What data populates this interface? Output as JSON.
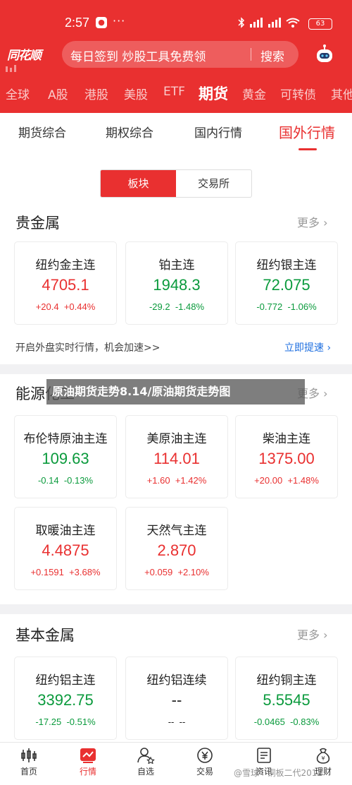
{
  "status_bar": {
    "time": "2:57",
    "dots": "···",
    "battery": "63"
  },
  "header": {
    "logo": "同花顺",
    "search_placeholder": "每日签到 炒股工具免费领",
    "search_button": "搜索"
  },
  "market_tabs": [
    "全球",
    "A股",
    "港股",
    "美股",
    "ETF",
    "期货",
    "黄金",
    "可转债",
    "其他"
  ],
  "market_tab_active": "期货",
  "sub_tabs": [
    "期货综合",
    "期权综合",
    "国内行情",
    "国外行情"
  ],
  "sub_tab_active": "国外行情",
  "segment": {
    "left": "板块",
    "right": "交易所",
    "active": "板块"
  },
  "sections": [
    {
      "title": "贵金属",
      "more": "更多",
      "cards": [
        {
          "name": "纽约金主连",
          "price": "4705.1",
          "change": "+20.4",
          "pct": "+0.44%",
          "trend": "up"
        },
        {
          "name": "铂主连",
          "price": "1948.3",
          "change": "-29.2",
          "pct": "-1.48%",
          "trend": "down"
        },
        {
          "name": "纽约银主连",
          "price": "72.075",
          "change": "-0.772",
          "pct": "-1.06%",
          "trend": "down"
        }
      ],
      "promo": "开启外盘实时行情，机会加速>>",
      "promo_link": "立即提速"
    },
    {
      "title": "能源化工",
      "more": "更多",
      "cards": [
        {
          "name": "布伦特原油主连",
          "price": "109.63",
          "change": "-0.14",
          "pct": "-0.13%",
          "trend": "down"
        },
        {
          "name": "美原油主连",
          "price": "114.01",
          "change": "+1.60",
          "pct": "+1.42%",
          "trend": "up"
        },
        {
          "name": "柴油主连",
          "price": "1375.00",
          "change": "+20.00",
          "pct": "+1.48%",
          "trend": "up"
        },
        {
          "name": "取暖油主连",
          "price": "4.4875",
          "change": "+0.1591",
          "pct": "+3.68%",
          "trend": "up"
        },
        {
          "name": "天然气主连",
          "price": "2.870",
          "change": "+0.059",
          "pct": "+2.10%",
          "trend": "up"
        }
      ]
    },
    {
      "title": "基本金属",
      "more": "更多",
      "cards": [
        {
          "name": "纽约铝主连",
          "price": "3392.75",
          "change": "-17.25",
          "pct": "-0.51%",
          "trend": "down"
        },
        {
          "name": "纽约铝连续",
          "price": "--",
          "change": "--",
          "pct": "--",
          "trend": "none"
        },
        {
          "name": "纽约铜主连",
          "price": "5.5545",
          "change": "-0.0465",
          "pct": "-0.83%",
          "trend": "down"
        }
      ]
    }
  ],
  "overlay_caption": "原油期货走势8.14/原油期货走势图",
  "bottom_nav": [
    {
      "label": "首页",
      "icon": "chart-bars-icon"
    },
    {
      "label": "行情",
      "icon": "market-trend-icon"
    },
    {
      "label": "自选",
      "icon": "person-star-icon"
    },
    {
      "label": "交易",
      "icon": "yen-coin-icon"
    },
    {
      "label": "资讯",
      "icon": "news-doc-icon"
    },
    {
      "label": "理财",
      "icon": "money-bag-icon"
    }
  ],
  "bottom_nav_active": "行情",
  "watermark": "@雪球 · 铜板二代2012",
  "colors": {
    "brand_red": "#e93030",
    "up": "#e93030",
    "down": "#0a9a3c",
    "link": "#1e6fe0"
  }
}
